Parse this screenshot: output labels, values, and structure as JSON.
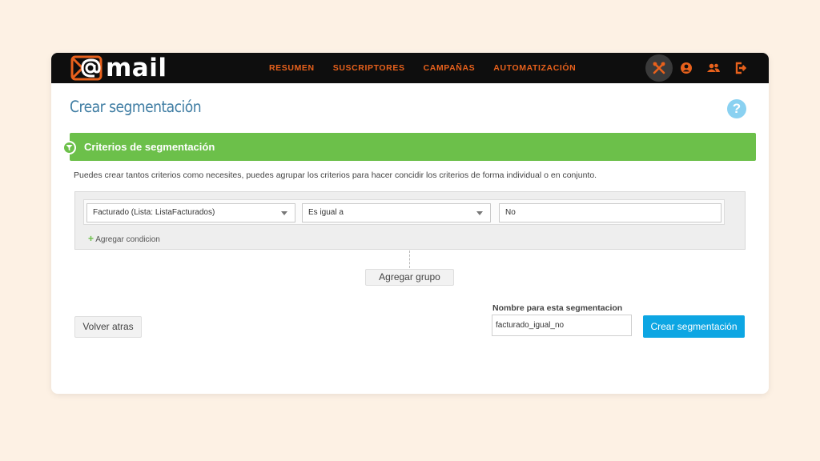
{
  "app": {
    "logo_text": "mail"
  },
  "nav": {
    "items": [
      "RESUMEN",
      "SUSCRIPTORES",
      "CAMPAÑAS",
      "AUTOMATIZACIÓN"
    ]
  },
  "header_icons": [
    "tools-icon",
    "user-icon",
    "users-icon",
    "logout-icon"
  ],
  "page": {
    "title": "Crear segmentación",
    "help_glyph": "?"
  },
  "section": {
    "title": "Criterios de segmentación",
    "description": "Puedes crear tantos criterios como necesites, puedes agrupar los criterios para hacer concidir los criterios de forma individual o en conjunto."
  },
  "condition": {
    "field": "Facturado (Lista: ListaFacturados)",
    "operator": "Es igual a",
    "value": "No"
  },
  "add_condition_label": "Agregar condicion",
  "add_group_label": "Agregar grupo",
  "back_label": "Volver atras",
  "name_field": {
    "label": "Nombre para esta segmentacion",
    "value": "facturado_igual_no"
  },
  "create_label": "Crear segmentación",
  "colors": {
    "accent": "#e8611c",
    "green": "#6cc04a",
    "blue": "#0da6e3",
    "title": "#3f7da3"
  }
}
